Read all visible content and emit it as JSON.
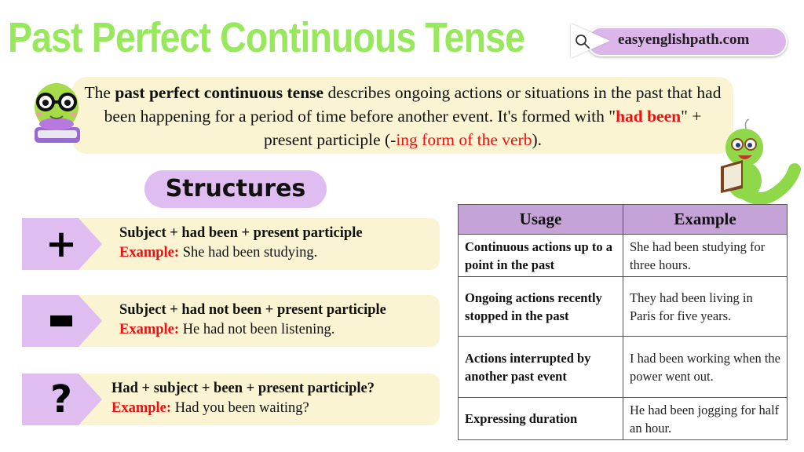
{
  "header": {
    "title": "Past Perfect Continuous Tense",
    "site": "easyenglishpath.com",
    "title_color": "#97e85a",
    "badge_color": "#dcb6ea"
  },
  "intro": {
    "part1": "The ",
    "bold": "past perfect continuous tense",
    "part2": " describes ongoing actions or situations in the past that had been happening for a period of time before another event. It's formed with \"",
    "formula": "had been",
    "part3": "\" + present participple",
    "part3_clean": "\" + present participle (-",
    "ing_text": "ing form of the verb",
    "part4": ").",
    "bg_color": "#fbf4d2"
  },
  "structures": {
    "heading": "Structures",
    "items": [
      {
        "symbol": "+",
        "icon": "plus-icon",
        "formula": "Subject + had been + present participle",
        "example_label": "Example:",
        "example": " She had been studying."
      },
      {
        "symbol": "-",
        "icon": "minus-icon",
        "formula": "Subject + had not been + present participle",
        "example_label": "Example:",
        "example": " He had not been listening."
      },
      {
        "symbol": "?",
        "icon": "question-icon",
        "formula": "Had + subject + been + present participle?",
        "example_label": "Example:",
        "example": " Had you been waiting?"
      }
    ]
  },
  "table": {
    "headers": [
      "Usage",
      "Example"
    ],
    "rows": [
      {
        "usage": "Continuous actions up to a point in the past",
        "example": "She had been studying for three hours."
      },
      {
        "usage": "Ongoing actions recently stopped in the past",
        "example": "They had been living in Paris for five years."
      },
      {
        "usage": "Actions interrupted by another past event",
        "example": "I had been working when the power went out."
      },
      {
        "usage": "Expressing duration",
        "example": "He had been jogging for half an hour."
      }
    ],
    "header_color": "#c6a3d6"
  }
}
